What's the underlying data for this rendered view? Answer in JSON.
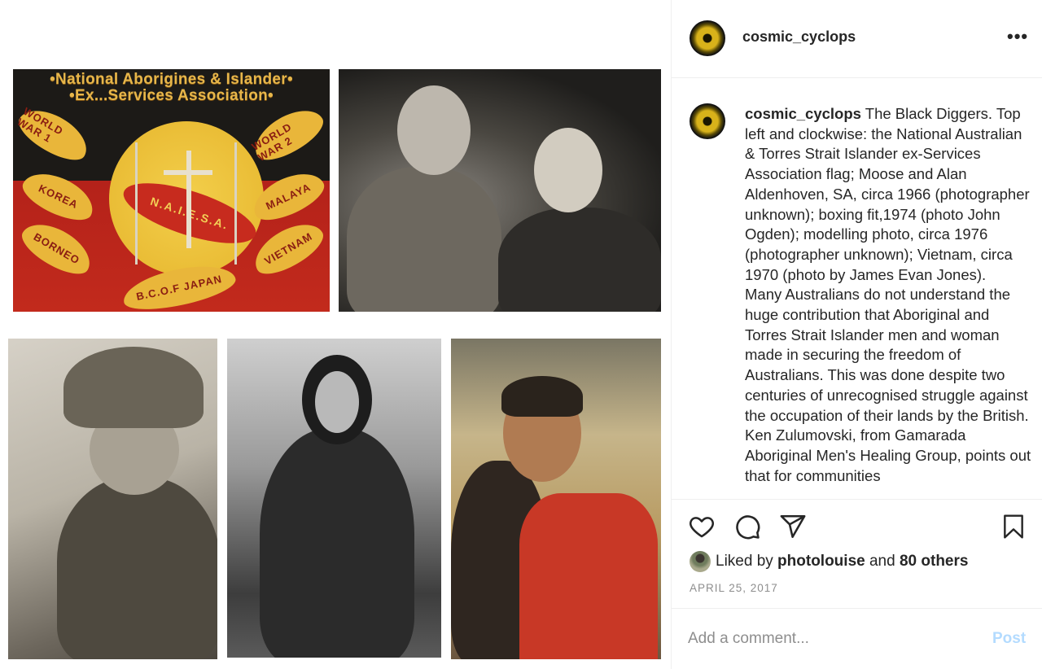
{
  "flag": {
    "line1": "•National Aborigines & Islander•",
    "line2": "•Ex...Services Association•",
    "center_label": "N.A.I.E.S.A.",
    "boomerangs": [
      "WORLD WAR 1",
      "WORLD WAR 2",
      "KOREA",
      "MALAYA",
      "BORNEO",
      "VIETNAM",
      "B.C.O.F JAPAN"
    ]
  },
  "post": {
    "username": "cosmic_cyclops",
    "more_label": "•••",
    "caption": "The Black Diggers. Top left and clockwise: the National Australian & Torres Strait Islander ex-Services Association flag; Moose and Alan Aldenhoven, SA, circa 1966 (photographer unknown); boxing fit,1974 (photo John Ogden); modelling photo, circa 1976 (photographer unknown); Vietnam, circa 1970 (photo by James Evan Jones).\nMany Australians do not understand the huge contribution that Aboriginal and Torres Strait Islander men and woman made in securing the freedom of Australians. This was done despite two centuries of unrecognised struggle against the occupation of their lands by the British. Ken Zulumovski, from Gamarada Aboriginal Men's Healing Group, points out that for communities",
    "liked_prefix": "Liked by ",
    "liked_user": "photolouise",
    "liked_and": " and ",
    "liked_others": "80 others",
    "date": "APRIL 25, 2017",
    "comment_placeholder": "Add a comment...",
    "post_label": "Post"
  },
  "icons": [
    "heart-icon",
    "comment-icon",
    "share-icon",
    "bookmark-icon",
    "more-icon"
  ],
  "colors": {
    "post_button": "#b3dbff",
    "muted": "#8e8e8e",
    "text": "#262626"
  }
}
